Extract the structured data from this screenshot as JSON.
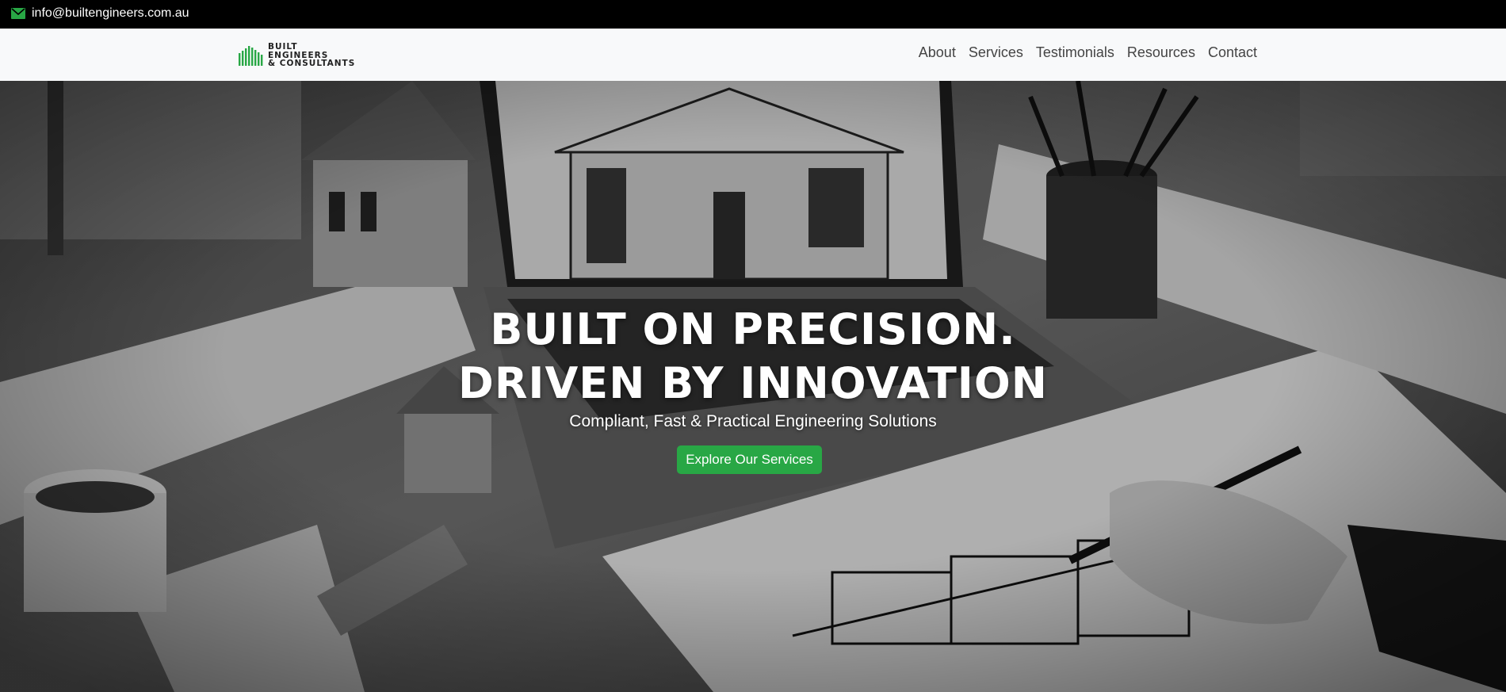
{
  "topbar": {
    "email": "info@builtengineers.com.au",
    "icon": "mail-icon"
  },
  "brand": {
    "line1": "BUILT",
    "line2": "ENGINEERS",
    "line3": "& CONSULTANTS",
    "accent": "#28a745"
  },
  "nav": {
    "items": [
      "About",
      "Services",
      "Testimonials",
      "Resources",
      "Contact"
    ]
  },
  "hero": {
    "headline_line1": "BUILT ON PRECISION.",
    "headline_line2": "DRIVEN BY INNOVATION",
    "subheading": "Compliant, Fast & Practical Engineering Solutions",
    "cta_label": "Explore Our Services",
    "cta_color": "#28a745"
  }
}
